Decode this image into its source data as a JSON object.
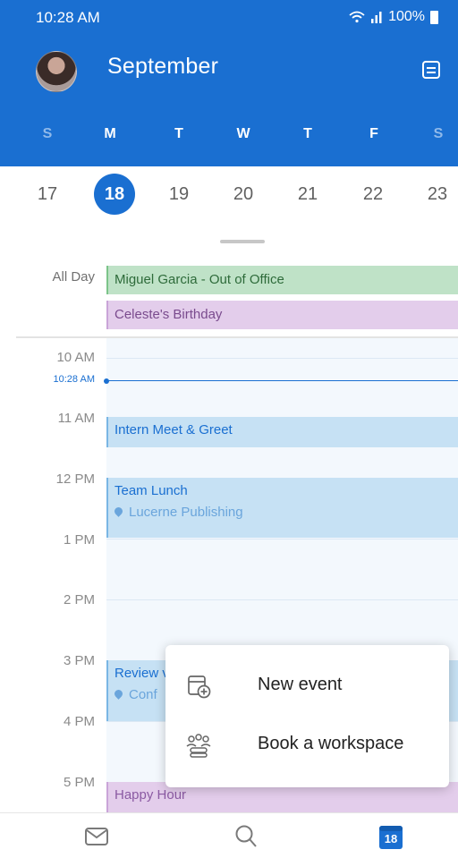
{
  "status_bar": {
    "time": "10:28 AM",
    "battery": "100%"
  },
  "header": {
    "month": "September",
    "weekdays": [
      "S",
      "M",
      "T",
      "W",
      "T",
      "F",
      "S"
    ],
    "dates": [
      "17",
      "18",
      "19",
      "20",
      "21",
      "22",
      "23"
    ],
    "selected_date": "18"
  },
  "all_day": {
    "label": "All Day",
    "events": [
      "Miguel Garcia - Out of Office",
      "Celeste's Birthday"
    ]
  },
  "timeline": {
    "hours": [
      "10 AM",
      "11 AM",
      "12 PM",
      "1 PM",
      "2 PM",
      "3 PM",
      "4 PM",
      "5 PM"
    ],
    "now_label": "10:28 AM",
    "events": [
      {
        "title": "Intern Meet & Greet"
      },
      {
        "title": "Team Lunch",
        "location": "Lucerne Publishing"
      },
      {
        "title": "Review v",
        "location": "Conf"
      },
      {
        "title": "Happy Hour"
      }
    ]
  },
  "popup_menu": {
    "items": [
      "New event",
      "Book a workspace"
    ]
  },
  "bottom_nav": {
    "items": [
      "mail-icon",
      "search-icon",
      "calendar-icon"
    ],
    "calendar_badge": "18"
  },
  "colors": {
    "accent": "#1a6fd1",
    "all_day_green": "#bfe2c7",
    "all_day_purple": "#e3cdeb",
    "event_blue": "#c6e1f4"
  }
}
